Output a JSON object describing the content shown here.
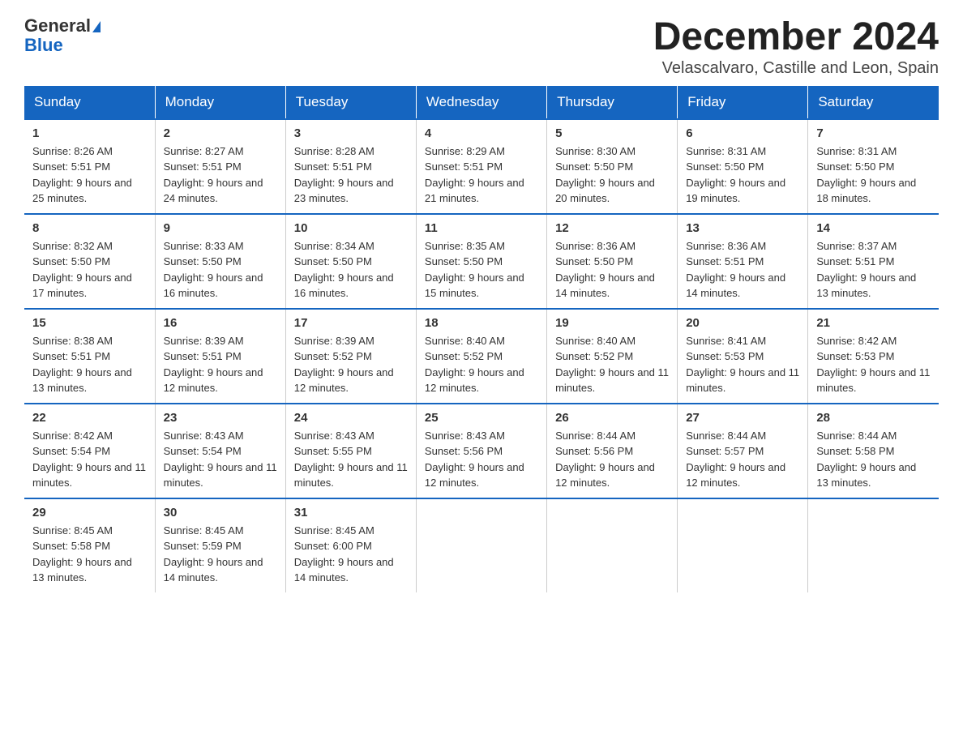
{
  "header": {
    "logo_general": "General",
    "logo_blue": "Blue",
    "title": "December 2024",
    "subtitle": "Velascalvaro, Castille and Leon, Spain"
  },
  "days_of_week": [
    "Sunday",
    "Monday",
    "Tuesday",
    "Wednesday",
    "Thursday",
    "Friday",
    "Saturday"
  ],
  "weeks": [
    [
      {
        "day": "1",
        "sunrise": "8:26 AM",
        "sunset": "5:51 PM",
        "daylight": "9 hours and 25 minutes."
      },
      {
        "day": "2",
        "sunrise": "8:27 AM",
        "sunset": "5:51 PM",
        "daylight": "9 hours and 24 minutes."
      },
      {
        "day": "3",
        "sunrise": "8:28 AM",
        "sunset": "5:51 PM",
        "daylight": "9 hours and 23 minutes."
      },
      {
        "day": "4",
        "sunrise": "8:29 AM",
        "sunset": "5:51 PM",
        "daylight": "9 hours and 21 minutes."
      },
      {
        "day": "5",
        "sunrise": "8:30 AM",
        "sunset": "5:50 PM",
        "daylight": "9 hours and 20 minutes."
      },
      {
        "day": "6",
        "sunrise": "8:31 AM",
        "sunset": "5:50 PM",
        "daylight": "9 hours and 19 minutes."
      },
      {
        "day": "7",
        "sunrise": "8:31 AM",
        "sunset": "5:50 PM",
        "daylight": "9 hours and 18 minutes."
      }
    ],
    [
      {
        "day": "8",
        "sunrise": "8:32 AM",
        "sunset": "5:50 PM",
        "daylight": "9 hours and 17 minutes."
      },
      {
        "day": "9",
        "sunrise": "8:33 AM",
        "sunset": "5:50 PM",
        "daylight": "9 hours and 16 minutes."
      },
      {
        "day": "10",
        "sunrise": "8:34 AM",
        "sunset": "5:50 PM",
        "daylight": "9 hours and 16 minutes."
      },
      {
        "day": "11",
        "sunrise": "8:35 AM",
        "sunset": "5:50 PM",
        "daylight": "9 hours and 15 minutes."
      },
      {
        "day": "12",
        "sunrise": "8:36 AM",
        "sunset": "5:50 PM",
        "daylight": "9 hours and 14 minutes."
      },
      {
        "day": "13",
        "sunrise": "8:36 AM",
        "sunset": "5:51 PM",
        "daylight": "9 hours and 14 minutes."
      },
      {
        "day": "14",
        "sunrise": "8:37 AM",
        "sunset": "5:51 PM",
        "daylight": "9 hours and 13 minutes."
      }
    ],
    [
      {
        "day": "15",
        "sunrise": "8:38 AM",
        "sunset": "5:51 PM",
        "daylight": "9 hours and 13 minutes."
      },
      {
        "day": "16",
        "sunrise": "8:39 AM",
        "sunset": "5:51 PM",
        "daylight": "9 hours and 12 minutes."
      },
      {
        "day": "17",
        "sunrise": "8:39 AM",
        "sunset": "5:52 PM",
        "daylight": "9 hours and 12 minutes."
      },
      {
        "day": "18",
        "sunrise": "8:40 AM",
        "sunset": "5:52 PM",
        "daylight": "9 hours and 12 minutes."
      },
      {
        "day": "19",
        "sunrise": "8:40 AM",
        "sunset": "5:52 PM",
        "daylight": "9 hours and 11 minutes."
      },
      {
        "day": "20",
        "sunrise": "8:41 AM",
        "sunset": "5:53 PM",
        "daylight": "9 hours and 11 minutes."
      },
      {
        "day": "21",
        "sunrise": "8:42 AM",
        "sunset": "5:53 PM",
        "daylight": "9 hours and 11 minutes."
      }
    ],
    [
      {
        "day": "22",
        "sunrise": "8:42 AM",
        "sunset": "5:54 PM",
        "daylight": "9 hours and 11 minutes."
      },
      {
        "day": "23",
        "sunrise": "8:43 AM",
        "sunset": "5:54 PM",
        "daylight": "9 hours and 11 minutes."
      },
      {
        "day": "24",
        "sunrise": "8:43 AM",
        "sunset": "5:55 PM",
        "daylight": "9 hours and 11 minutes."
      },
      {
        "day": "25",
        "sunrise": "8:43 AM",
        "sunset": "5:56 PM",
        "daylight": "9 hours and 12 minutes."
      },
      {
        "day": "26",
        "sunrise": "8:44 AM",
        "sunset": "5:56 PM",
        "daylight": "9 hours and 12 minutes."
      },
      {
        "day": "27",
        "sunrise": "8:44 AM",
        "sunset": "5:57 PM",
        "daylight": "9 hours and 12 minutes."
      },
      {
        "day": "28",
        "sunrise": "8:44 AM",
        "sunset": "5:58 PM",
        "daylight": "9 hours and 13 minutes."
      }
    ],
    [
      {
        "day": "29",
        "sunrise": "8:45 AM",
        "sunset": "5:58 PM",
        "daylight": "9 hours and 13 minutes."
      },
      {
        "day": "30",
        "sunrise": "8:45 AM",
        "sunset": "5:59 PM",
        "daylight": "9 hours and 14 minutes."
      },
      {
        "day": "31",
        "sunrise": "8:45 AM",
        "sunset": "6:00 PM",
        "daylight": "9 hours and 14 minutes."
      },
      null,
      null,
      null,
      null
    ]
  ]
}
